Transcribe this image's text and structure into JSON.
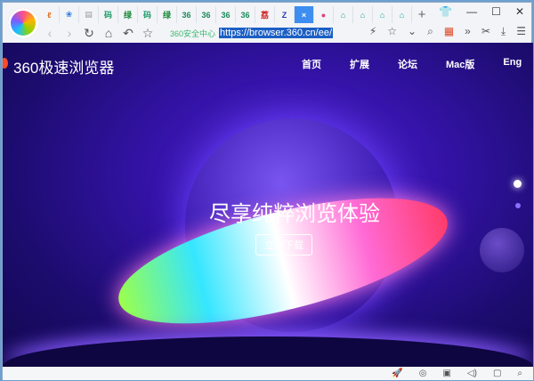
{
  "tabs": [
    {
      "icon": "ℓ",
      "color": "#e07020"
    },
    {
      "icon": "❀",
      "color": "#2a7ae0"
    },
    {
      "icon": "▤",
      "color": "#999"
    },
    {
      "icon": "码",
      "color": "#1a9a6a"
    },
    {
      "icon": "绿",
      "color": "#1a8a3a"
    },
    {
      "icon": "码",
      "color": "#1a9a6a"
    },
    {
      "icon": "绿",
      "color": "#1a8a3a"
    },
    {
      "icon": "36",
      "color": "#1a8a5a"
    },
    {
      "icon": "36",
      "color": "#1a8a5a"
    },
    {
      "icon": "36",
      "color": "#1a8a5a"
    },
    {
      "icon": "36",
      "color": "#1a8a5a"
    },
    {
      "icon": "荔",
      "color": "#d02020"
    },
    {
      "icon": "Z",
      "color": "#2a3ab0"
    },
    {
      "icon": "×",
      "color": "#fff",
      "active": true
    },
    {
      "icon": "●",
      "color": "#e04070"
    },
    {
      "icon": "⌂",
      "color": "#20a0a0"
    },
    {
      "icon": "⌂",
      "color": "#20a0a0"
    },
    {
      "icon": "⌂",
      "color": "#20a0a0"
    },
    {
      "icon": "⌂",
      "color": "#20a0a0"
    }
  ],
  "new_tab": "+",
  "window_buttons": {
    "skin": "👕",
    "minimize": "—",
    "maximize": "☐",
    "close": "✕"
  },
  "nav": {
    "back": "‹",
    "forward": "›",
    "reload": "↻",
    "home": "⌂",
    "undo": "↶",
    "favorite": "☆"
  },
  "address": {
    "security_label": "360安全中心",
    "url": "https://browser.360.cn/ee/"
  },
  "toolbar_right": {
    "speed": "⚡",
    "star": "☆",
    "dropdown": "⌄",
    "search": "⌕",
    "apps": "▦",
    "more": "»",
    "cut": "✂",
    "download": "⤓",
    "menu": "☰"
  },
  "page": {
    "brand": "360极速浏览器",
    "menu": [
      "首页",
      "扩展",
      "论坛",
      "Mac版",
      "Eng"
    ],
    "slogan": "尽享纯粹浏览体验",
    "download_button": "立即下载"
  },
  "status_icons": [
    "🚀",
    "◎",
    "▣",
    "◁)",
    "▢",
    "⌕"
  ]
}
